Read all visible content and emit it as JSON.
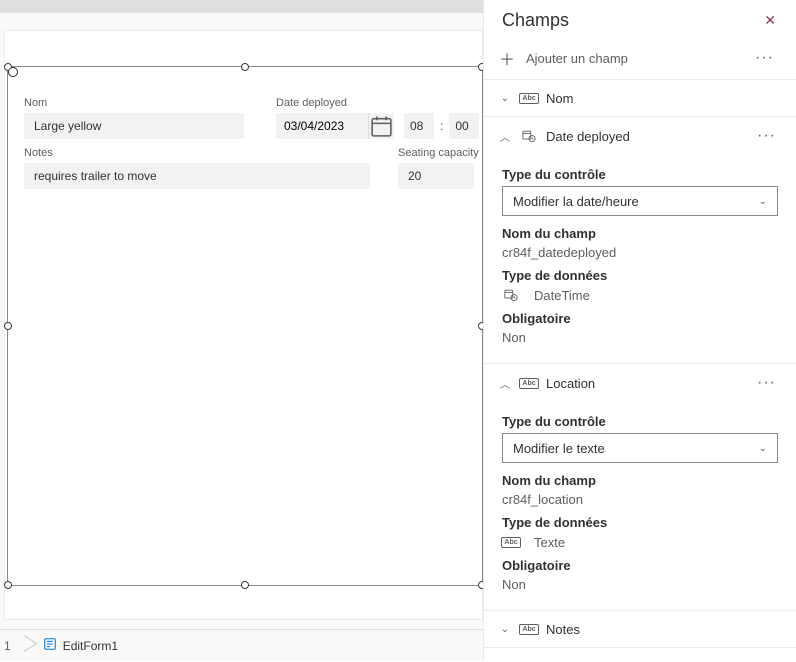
{
  "panel": {
    "title": "Champs",
    "add_label": "Ajouter un champ"
  },
  "form": {
    "nom_label": "Nom",
    "nom_value": "Large yellow",
    "date_label": "Date deployed",
    "date_value": "03/04/2023",
    "hour_value": "08",
    "minute_value": "00",
    "notes_label": "Notes",
    "notes_value": "requires trailer to move",
    "seating_label": "Seating capacity",
    "seating_value": "20"
  },
  "fields": {
    "nom": {
      "name": "Nom"
    },
    "date": {
      "name": "Date deployed",
      "control_label": "Type du contrôle",
      "control_value": "Modifier la date/heure",
      "fieldname_label": "Nom du champ",
      "fieldname_value": "cr84f_datedeployed",
      "datatype_label": "Type de données",
      "datatype_value": "DateTime",
      "required_label": "Obligatoire",
      "required_value": "Non"
    },
    "location": {
      "name": "Location",
      "control_label": "Type du contrôle",
      "control_value": "Modifier le texte",
      "fieldname_label": "Nom du champ",
      "fieldname_value": "cr84f_location",
      "datatype_label": "Type de données",
      "datatype_value": "Texte",
      "required_label": "Obligatoire",
      "required_value": "Non"
    },
    "notes": {
      "name": "Notes"
    }
  },
  "breadcrumb": {
    "item1_suffix": "1",
    "item2": "EditForm1"
  }
}
